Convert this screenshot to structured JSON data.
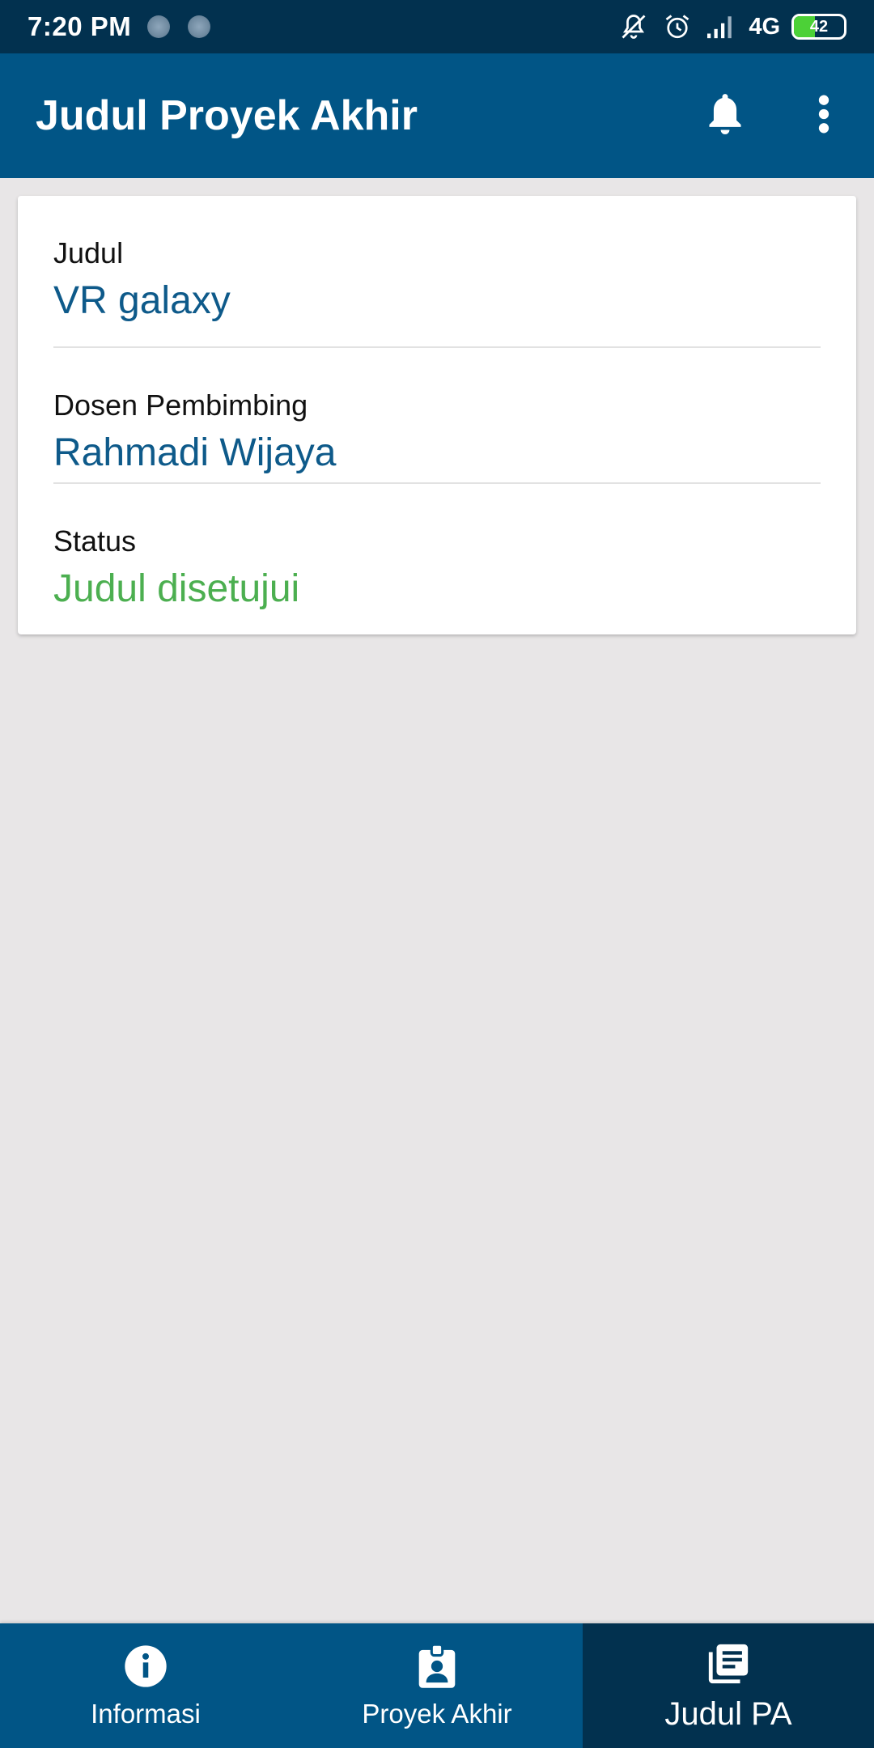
{
  "status_bar": {
    "time": "7:20 PM",
    "network": "4G",
    "battery": "42",
    "icons": [
      "notification-dot",
      "notification-dot",
      "mute-icon",
      "alarm-icon",
      "signal-icon"
    ]
  },
  "app_bar": {
    "title": "Judul Proyek Akhir",
    "actions": [
      "bell-icon",
      "more-vert-icon"
    ]
  },
  "card": {
    "fields": [
      {
        "label": "Judul",
        "value": "VR galaxy"
      },
      {
        "label": "Dosen Pembimbing",
        "value": "Rahmadi Wijaya"
      },
      {
        "label": "Status",
        "value": "Judul disetujui"
      }
    ]
  },
  "bottom_nav": {
    "items": [
      {
        "label": "Informasi",
        "icon": "info-icon",
        "active": false
      },
      {
        "label": "Proyek Akhir",
        "icon": "badge-icon",
        "active": false
      },
      {
        "label": "Judul PA",
        "icon": "library-books-icon",
        "active": true
      }
    ]
  },
  "colors": {
    "status_bar": "#02314f",
    "app_bar": "#015586",
    "value_blue": "#0e5a8a",
    "status_green": "#4caf50",
    "background": "#e8e6e7"
  }
}
